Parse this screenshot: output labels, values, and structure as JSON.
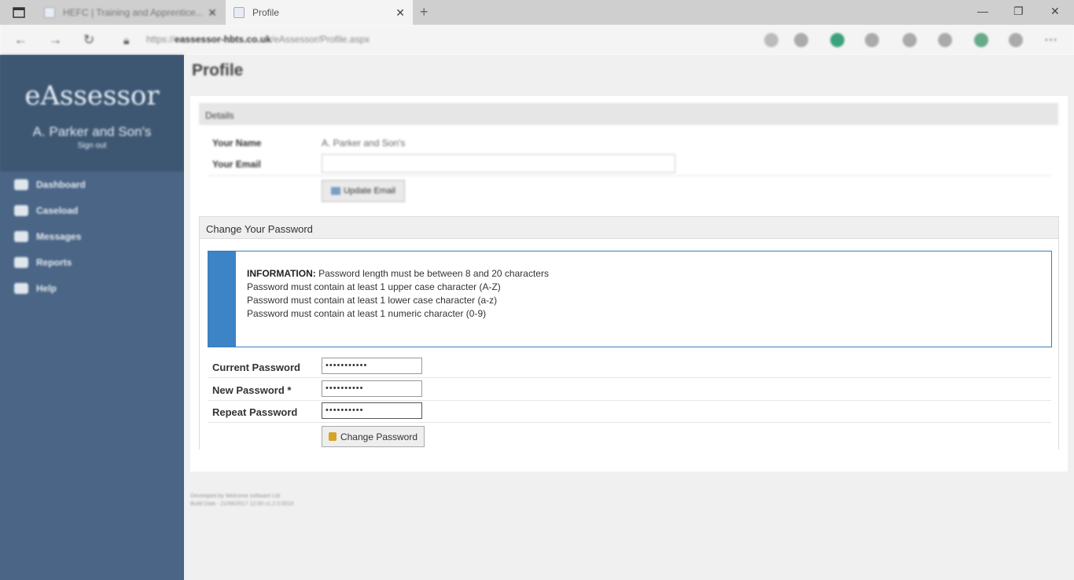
{
  "browser": {
    "tabs": [
      {
        "title": "HEFC | Training and Apprentice...",
        "active": false
      },
      {
        "title": "Profile",
        "active": true
      }
    ],
    "url_prefix": "https://",
    "url_domain": "eassessor-hbts.co.uk",
    "url_path": "/eAssessor/Profile.aspx"
  },
  "sidebar": {
    "brand": "eAssessor",
    "company": "A. Parker and Son's",
    "signout": "Sign out",
    "items": [
      {
        "label": "Dashboard",
        "icon": "dashboard-icon"
      },
      {
        "label": "Caseload",
        "icon": "caseload-icon"
      },
      {
        "label": "Messages",
        "icon": "messages-icon"
      },
      {
        "label": "Reports",
        "icon": "reports-icon"
      },
      {
        "label": "Help",
        "icon": "help-icon"
      }
    ]
  },
  "main": {
    "title": "Profile",
    "details": {
      "header": "Details",
      "name_label": "Your Name",
      "name_value": "A. Parker and Son's",
      "email_label": "Your Email",
      "email_value": "",
      "update_label": "Update Email"
    },
    "password": {
      "header": "Change Your Password",
      "info_title": "INFORMATION:",
      "info_lines": [
        "Password length must be between 8 and 20 characters",
        "Password must contain at least 1 upper case character (A-Z)",
        "Password must contain at least 1 lower case character (a-z)",
        "Password must contain at least 1 numeric character (0-9)"
      ],
      "fields": [
        {
          "label": "Current Password",
          "value": "•••••••••••"
        },
        {
          "label": "New Password *",
          "value": "••••••••••"
        },
        {
          "label": "Repeat Password",
          "value": "••••••••••"
        }
      ],
      "submit_label": "Change Password"
    },
    "footer": {
      "line1": "Developed by Welcome software Ltd",
      "line2": "Build Date - 21/06/2017 12:00 v1.2.0.0015"
    }
  }
}
